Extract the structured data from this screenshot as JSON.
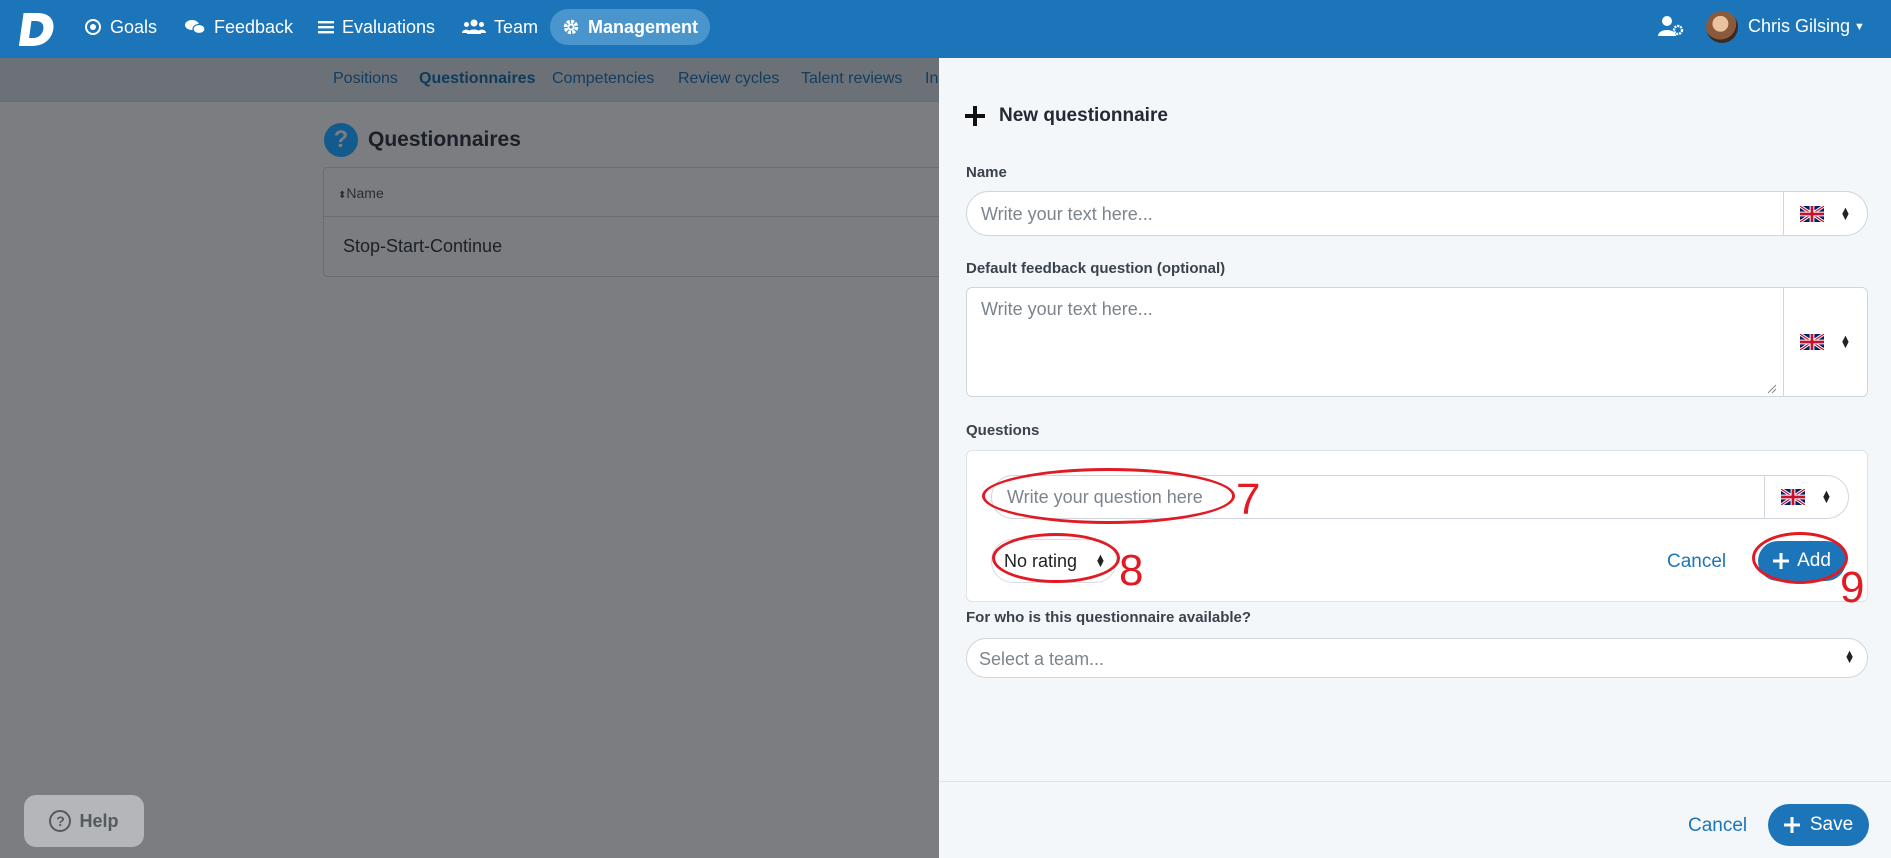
{
  "nav": {
    "items": [
      {
        "label": "Goals",
        "icon": "target-icon"
      },
      {
        "label": "Feedback",
        "icon": "comments-icon"
      },
      {
        "label": "Evaluations",
        "icon": "list-icon"
      },
      {
        "label": "Team",
        "icon": "users-icon"
      },
      {
        "label": "Management",
        "icon": "gear-icon",
        "active": true
      }
    ],
    "user_name": "Chris Gilsing"
  },
  "subnav": {
    "items": [
      "Positions",
      "Questionnaires",
      "Competencies",
      "Review cycles",
      "Talent reviews",
      "In"
    ]
  },
  "page": {
    "title": "Questionnaires",
    "table_header": "Name",
    "rows": [
      "Stop-Start-Continue"
    ],
    "help_label": "Help"
  },
  "panel": {
    "title": "New questionnaire",
    "name_label": "Name",
    "name_placeholder": "Write your text here...",
    "feedback_label": "Default feedback question (optional)",
    "feedback_placeholder": "Write your text here...",
    "questions_label": "Questions",
    "question_placeholder": "Write your question here",
    "rating_value": "No rating",
    "question_cancel": "Cancel",
    "question_add": "Add",
    "team_label": "For who is this questionnaire available?",
    "team_placeholder": "Select a team...",
    "footer_cancel": "Cancel",
    "footer_save": "Save"
  },
  "annotations": [
    "7",
    "8",
    "9"
  ],
  "colors": {
    "brand": "#1c75b9",
    "annotation": "#e01b24",
    "overlay": "#7b7d80"
  }
}
